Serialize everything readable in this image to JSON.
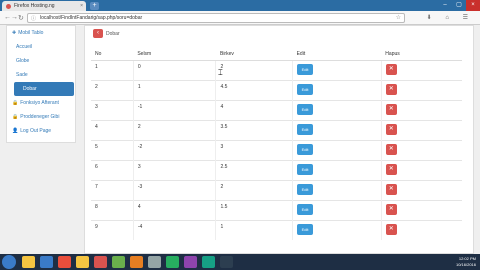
{
  "browser": {
    "tab_title": "Firefox Hosting.ng",
    "tab_close": "×",
    "new_tab": "+",
    "url": "localhost/FindIntFandarig/sap.php/soru=dobar",
    "lock": "ⓘ",
    "star": "☆",
    "back": "←",
    "forward": "→",
    "reload": "↻",
    "home": "⌂",
    "win_min": "–",
    "win_max": "▢",
    "win_close": "×",
    "toolbar_icons": "⬇ ⌂ ☰"
  },
  "sidebar": {
    "items": [
      {
        "icon": "✚",
        "label": "Mobil Tablo",
        "active": false,
        "head": true
      },
      {
        "icon": "",
        "label": "Accueil",
        "active": false,
        "sub": true
      },
      {
        "icon": "",
        "label": "Globe",
        "active": false,
        "sub": true
      },
      {
        "icon": "",
        "label": "Sade",
        "active": false,
        "sub": true
      },
      {
        "icon": "",
        "label": "Dobar",
        "active": true,
        "sub": true
      },
      {
        "icon": "🔒",
        "label": "Fonksiyo Afterant",
        "active": false
      },
      {
        "icon": "🔒",
        "label": "Proddeneger Gibi",
        "active": false
      },
      {
        "icon": "👤",
        "label": "Log Out Page",
        "active": false
      }
    ]
  },
  "content": {
    "back_icon": "‹",
    "back_label": "Dobar",
    "columns": [
      "No",
      "Selsm",
      "Birkev",
      "Edit",
      "Hapus"
    ],
    "edit_label": "Edit",
    "delete_icon": "✕",
    "rows": [
      [
        "1",
        "0",
        "2"
      ],
      [
        "2",
        "1",
        "4.5"
      ],
      [
        "3",
        "-1",
        "4"
      ],
      [
        "4",
        "2",
        "3.5"
      ],
      [
        "5",
        "-2",
        "3"
      ],
      [
        "6",
        "3",
        "2.5"
      ],
      [
        "7",
        "-3",
        "2"
      ],
      [
        "8",
        "4",
        "1.5"
      ],
      [
        "9",
        "-4",
        "1"
      ]
    ]
  },
  "taskbar": {
    "time": "12:02 PM",
    "date": "10/16/2016",
    "icon_colors": [
      "#f5c542",
      "#3a7bc8",
      "#e94e3c",
      "#f5c542",
      "#d9534f",
      "#6ab04c",
      "#e67e22",
      "#95a5a6",
      "#27ae60",
      "#8e44ad",
      "#16a085",
      "#2c3e50"
    ]
  },
  "colors": {
    "primary": "#337ab7",
    "edit": "#3a9ad9",
    "delete": "#d9534f"
  }
}
